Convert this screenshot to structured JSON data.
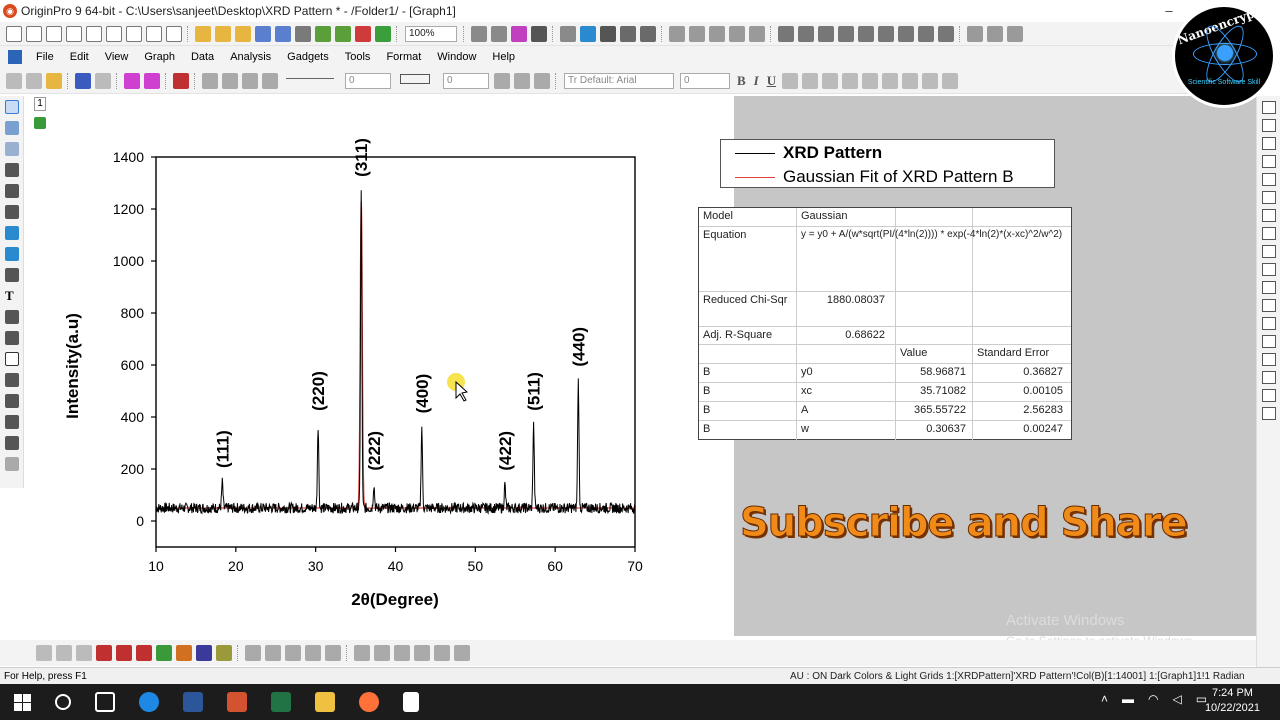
{
  "window": {
    "title": "OriginPro 9 64-bit - C:\\Users\\sanjeet\\Desktop\\XRD Pattern * - /Folder1/ - [Graph1]",
    "minimize": "–",
    "maximize": "□",
    "close": "✕"
  },
  "toolbar1": {
    "zoom_value": "100%"
  },
  "menu": {
    "items": [
      "File",
      "Edit",
      "View",
      "Graph",
      "Data",
      "Analysis",
      "Gadgets",
      "Tools",
      "Format",
      "Window",
      "Help"
    ]
  },
  "toolbar2": {
    "font_name": "Tr Default: Arial",
    "font_size": "0",
    "line_width": "0",
    "line_width_2": "0",
    "bold": "B",
    "italic": "I",
    "underline": "U"
  },
  "graph": {
    "layer_label": "1"
  },
  "chart_data": {
    "type": "line",
    "title": "",
    "xlabel": "2θ(Degree)",
    "ylabel": "Intensity(a.u)",
    "xlim": [
      10,
      70
    ],
    "ylim": [
      -100,
      1400
    ],
    "xticks": [
      "10",
      "20",
      "30",
      "40",
      "50",
      "60",
      "70"
    ],
    "yticks": [
      "0",
      "200",
      "400",
      "600",
      "800",
      "1000",
      "1200",
      "1400"
    ],
    "colors": {
      "xrd": "#000000",
      "fit": "#e04040"
    },
    "series": [
      {
        "name": "XRD Pattern",
        "x": [
          18.3,
          30.3,
          35.7,
          37.3,
          43.3,
          53.7,
          57.3,
          62.9
        ],
        "y": [
          150,
          370,
          1270,
          140,
          360,
          140,
          370,
          540
        ]
      },
      {
        "name": "Gaussian Fit of XRD Pattern B",
        "x": [
          35.71
        ],
        "y": [
          1230
        ]
      }
    ],
    "peak_labels": [
      {
        "label": "(111)",
        "x": 18.3,
        "y": 150
      },
      {
        "label": "(220)",
        "x": 30.3,
        "y": 370
      },
      {
        "label": "(311)",
        "x": 35.7,
        "y": 1270
      },
      {
        "label": "(222)",
        "x": 37.3,
        "y": 140
      },
      {
        "label": "(400)",
        "x": 43.3,
        "y": 360
      },
      {
        "label": "(422)",
        "x": 53.7,
        "y": 140
      },
      {
        "label": "(511)",
        "x": 57.3,
        "y": 370
      },
      {
        "label": "(440)",
        "x": 62.9,
        "y": 540
      }
    ],
    "baseline": 50
  },
  "legend": {
    "entries": [
      {
        "label": "XRD Pattern",
        "color": "#000000"
      },
      {
        "label": "Gaussian Fit of XRD Pattern B",
        "color": "#e04040"
      }
    ]
  },
  "fit_table": {
    "model_label": "Model",
    "model_value": "Gaussian",
    "equation_label": "Equation",
    "equation_value": "y = y0 + A/(w*sqrt(PI/(4*ln(2)))) * exp(-4*ln(2)*(x-xc)^2/w^2)",
    "chi_label": "Reduced Chi-Sqr",
    "chi_value": "1880.08037",
    "r2_label": "Adj. R-Square",
    "r2_value": "0.68622",
    "value_header": "Value",
    "error_header": "Standard Error",
    "params": [
      {
        "group": "B",
        "name": "y0",
        "value": "58.96871",
        "error": "0.36827"
      },
      {
        "group": "B",
        "name": "xc",
        "value": "35.71082",
        "error": "0.00105"
      },
      {
        "group": "B",
        "name": "A",
        "value": "365.55722",
        "error": "2.56283"
      },
      {
        "group": "B",
        "name": "w",
        "value": "0.30637",
        "error": "0.00247"
      }
    ]
  },
  "overlay": {
    "subscribe_text": "Subscribe and Share",
    "activate_title": "Activate Windows",
    "activate_sub": "Go to Settings to activate Windows.",
    "logo_text": "Nanoencryption",
    "logo_sub": "Scientific Software Skill"
  },
  "statusbar": {
    "help": "For Help, press F1",
    "info": "AU : ON  Dark Colors & Light Grids  1:[XRDPattern]'XRD Pattern'!Col(B)[1:14001]  1:[Graph1]1!1  Radian"
  },
  "taskbar": {
    "time": "7:24 PM",
    "date": "10/22/2021"
  }
}
